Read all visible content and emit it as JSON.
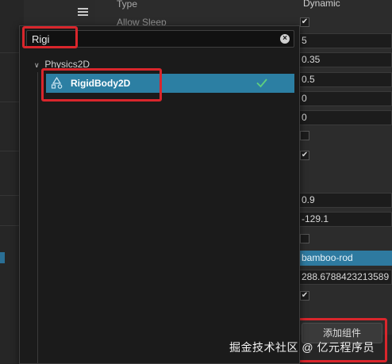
{
  "inspector": {
    "labels": {
      "type": "Type",
      "allow_sleep": "Allow Sleep"
    },
    "values": {
      "type_value": "Dynamic",
      "v1": "5",
      "v2": "0.35",
      "v3": "0.5",
      "v4": "0",
      "v5": "0",
      "v6": "0.9",
      "v7": "-129.1",
      "asset": "bamboo-rod",
      "v8": "288.6788423213589"
    },
    "add_component_label": "添加组件"
  },
  "search": {
    "value": "Rigi",
    "placeholder": ""
  },
  "results": {
    "group_label": "Physics2D",
    "item_label": "RigidBody2D"
  },
  "watermark": "掘金技术社区 @ 亿元程序员",
  "colors": {
    "selection": "#2c7fa3",
    "highlight_box": "#d9262c",
    "check": "#5fcf7d"
  }
}
